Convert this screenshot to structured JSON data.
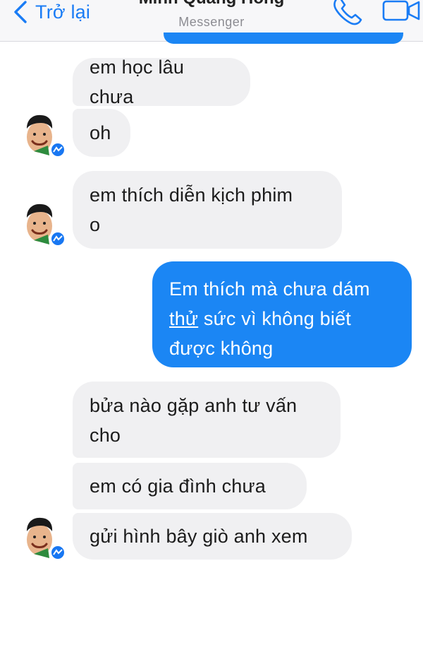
{
  "header": {
    "back_label": "Trở lại",
    "title": "Minh Quang Hồng",
    "subtitle": "Messenger",
    "icons": {
      "back": "chevron-left-icon",
      "call": "phone-icon",
      "video": "video-camera-icon"
    },
    "accent_color": "#1a7cf5"
  },
  "messages": [
    {
      "from": "contact",
      "text": "em học lâu chưa"
    },
    {
      "from": "contact",
      "text": "oh"
    },
    {
      "from": "contact",
      "lines": [
        "em thích diễn kịch phim",
        "o"
      ]
    },
    {
      "from": "me",
      "lines": [
        "Em thích mà chưa dám",
        "thử",
        " sức vì không biết",
        "được không"
      ]
    },
    {
      "from": "contact",
      "lines": [
        "bửa nào gặp anh tư vấn",
        "cho"
      ]
    },
    {
      "from": "contact",
      "text": "em có gia đình chưa"
    },
    {
      "from": "contact",
      "text": "gửi hình bây giò anh xem"
    }
  ],
  "colors": {
    "sent_bubble": "#1b86f4",
    "received_bubble": "#f0f0f2",
    "messenger_badge": "#1877f2"
  }
}
